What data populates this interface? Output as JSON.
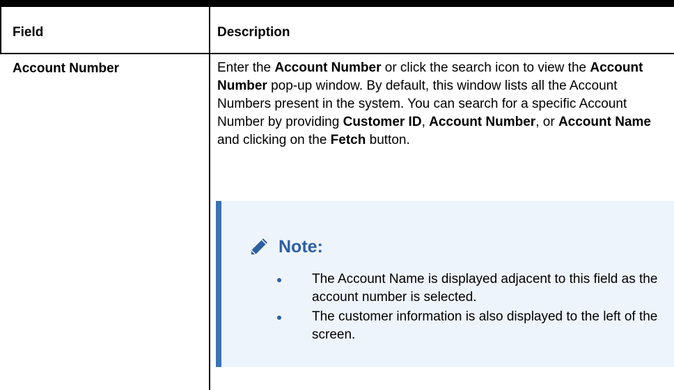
{
  "table": {
    "header_field": "Field",
    "header_description": "Description",
    "rows": [
      {
        "field": "Account Number",
        "desc_parts": [
          {
            "t": "Enter the ",
            "b": false
          },
          {
            "t": "Account Number",
            "b": true
          },
          {
            "t": " or click the search icon to view the ",
            "b": false
          },
          {
            "t": "Account Number",
            "b": true
          },
          {
            "t": " pop-up window. By default, this window lists all the Account Numbers present in the system. You can search for a specific Account Number by providing ",
            "b": false
          },
          {
            "t": "Customer ID",
            "b": true
          },
          {
            "t": ", ",
            "b": false
          },
          {
            "t": "Account Number",
            "b": true
          },
          {
            "t": ", or ",
            "b": false
          },
          {
            "t": "Account Name",
            "b": true
          },
          {
            "t": " and clicking on the ",
            "b": false
          },
          {
            "t": "Fetch",
            "b": true
          },
          {
            "t": " button.",
            "b": false
          }
        ],
        "note": {
          "icon": "pencil-icon",
          "label": "Note:",
          "items": [
            "The Account Name is displayed adjacent to this field as the account number is selected.",
            "The customer information is also displayed to the left of the screen."
          ]
        }
      }
    ]
  },
  "colors": {
    "note_background": "#eef4fb",
    "note_accent": "#3b73b5",
    "note_title": "#2d5fa0"
  }
}
